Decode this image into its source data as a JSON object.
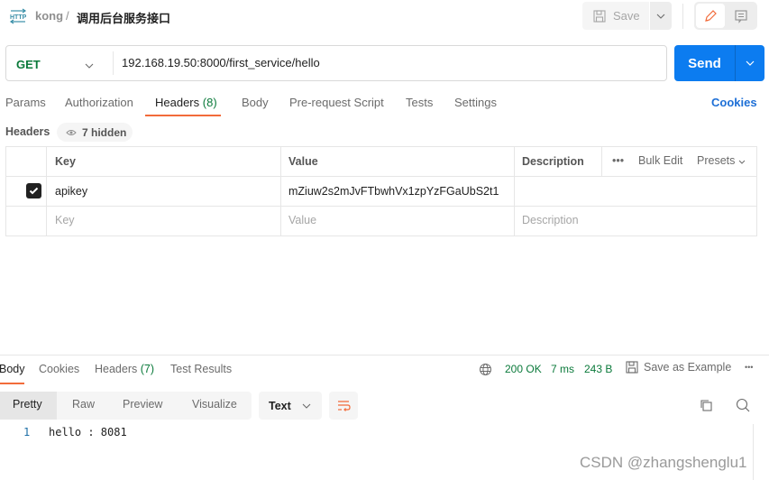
{
  "breadcrumb": {
    "protocol_icon": "http-icon",
    "parent": "kong",
    "separator": "/",
    "title": "调用后台服务接口"
  },
  "toolbar": {
    "save_label": "Save",
    "save_icon": "floppy-disk-icon",
    "edit_icon": "pencil-icon",
    "docs_icon": "comment-icon"
  },
  "request": {
    "method": "GET",
    "url": "192.168.19.50:8000/first_service/hello",
    "send_label": "Send"
  },
  "tabs": [
    {
      "label": "Params",
      "count": ""
    },
    {
      "label": "Authorization",
      "count": ""
    },
    {
      "label": "Headers",
      "count": "(8)",
      "active": true
    },
    {
      "label": "Body",
      "count": ""
    },
    {
      "label": "Pre-request Script",
      "count": ""
    },
    {
      "label": "Tests",
      "count": ""
    },
    {
      "label": "Settings",
      "count": ""
    }
  ],
  "cookies_link": "Cookies",
  "headers_section": {
    "label": "Headers",
    "hidden_pill": "7 hidden",
    "columns": [
      "Key",
      "Value",
      "Description"
    ],
    "actions": {
      "more": "•••",
      "bulk_edit": "Bulk Edit",
      "presets": "Presets"
    },
    "rows": [
      {
        "checked": true,
        "key": "apikey",
        "value": "mZiuw2s2mJvFTbwhVx1zpYzFGaUbS2t1",
        "description": ""
      }
    ],
    "placeholders": {
      "key": "Key",
      "value": "Value",
      "description": "Description"
    }
  },
  "response": {
    "tabs": [
      {
        "label": "Body",
        "active": true
      },
      {
        "label": "Cookies"
      },
      {
        "label": "Headers",
        "count": "(7)"
      },
      {
        "label": "Test Results"
      }
    ],
    "status": "200 OK",
    "time": "7 ms",
    "size": "243 B",
    "save_example": "Save as Example",
    "more": "•••",
    "formats": [
      "Pretty",
      "Raw",
      "Preview",
      "Visualize"
    ],
    "active_format": "Pretty",
    "content_type": "Text",
    "lines": [
      {
        "num": "1",
        "text": "hello : 8081"
      }
    ]
  },
  "watermark": "CSDN @zhangshenglu1",
  "colors": {
    "accent_orange": "#f26b3a",
    "send_blue": "#0c7cf0",
    "status_green": "#0b7a3b",
    "link_blue": "#1d6fd6"
  }
}
